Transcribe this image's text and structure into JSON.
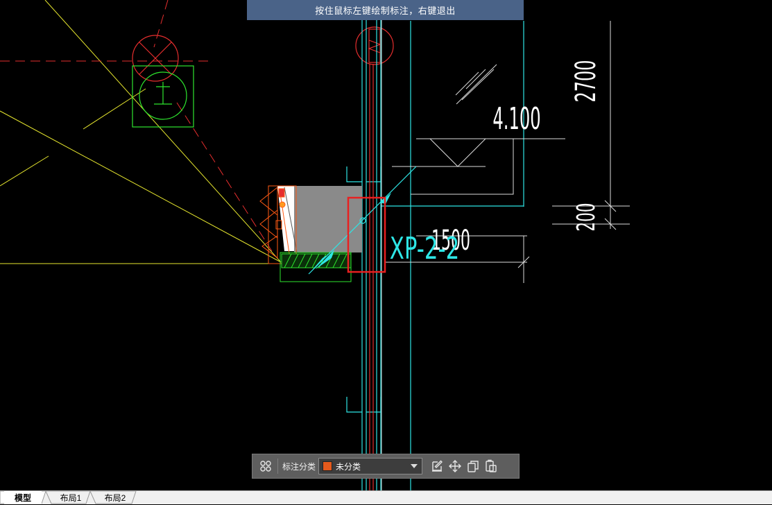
{
  "hint": {
    "text": "按住鼠标左键绘制标注，右键退出"
  },
  "drawing": {
    "elevation_text": "4.100",
    "dim_2700": "2700",
    "dim_200": "200",
    "dim_1500": "1500",
    "section_label": "XP-2-2"
  },
  "toolbar": {
    "category_label": "标注分类",
    "category_value": "未分类",
    "category_color": "#e65a1c",
    "icons": [
      "grid-icon",
      "edit-icon",
      "move-icon",
      "copy-icon",
      "paste-icon"
    ]
  },
  "tabs": [
    {
      "label": "模型",
      "active": true
    },
    {
      "label": "布局1",
      "active": false
    },
    {
      "label": "布局2",
      "active": false
    }
  ],
  "colors": {
    "background": "#000000",
    "cyan": "#2ee6e6",
    "red": "#e62e2e",
    "yellow": "#e6e62e",
    "green": "#2ee62e",
    "white": "#ffffff",
    "highlight": "#e82020",
    "hint_bar": "#4a6388"
  }
}
